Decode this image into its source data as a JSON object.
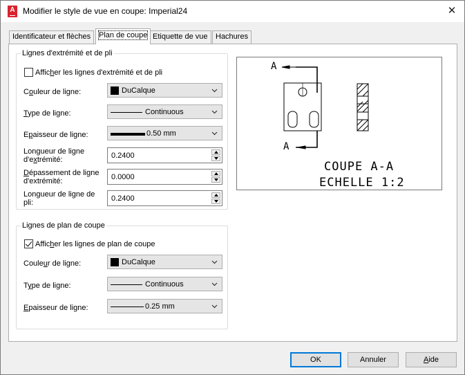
{
  "window": {
    "title": "Modifier le style de vue en coupe: Imperial24",
    "app_icon_letter": "A",
    "close_glyph": "✕"
  },
  "tabs": [
    {
      "label": "Identificateur et flèches",
      "active": false
    },
    {
      "label": "Plan de coupe",
      "active": true
    },
    {
      "label": "Etiquette de vue",
      "active": false
    },
    {
      "label": "Hachures",
      "active": false
    }
  ],
  "end_lines": {
    "group_title": "Lignes d'extrémité et de pli",
    "show_checkbox": {
      "label_pre": "Affic",
      "label_u": "h",
      "label_post": "er les lignes d'extrémité et de pli",
      "checked": false
    },
    "color": {
      "label_pre": "C",
      "label_u": "o",
      "label_post": "uleur de ligne:",
      "value": "DuCalque"
    },
    "linetype": {
      "label_pre": "",
      "label_u": "T",
      "label_post": "ype de ligne:",
      "value": "Continuous"
    },
    "lineweight": {
      "label_pre": "E",
      "label_u": "p",
      "label_post": "aisseur de ligne:",
      "value": "0.50 mm"
    },
    "end_length": {
      "label_l1": "Longueur de ligne",
      "label_l2_pre": "d'e",
      "label_l2_u": "x",
      "label_l2_post": "trémité:",
      "value": "0.2400"
    },
    "overshoot": {
      "label_l1_pre": "",
      "label_l1_u": "D",
      "label_l1_post": "épassement de ligne",
      "label_l2": "d'extrémité:",
      "value": "0.0000"
    },
    "bend_length": {
      "label_l1": "Longueur de ligne de",
      "label_l2": "pli:",
      "value": "0.2400"
    }
  },
  "cutting_plane": {
    "group_title": "Lignes de plan de coupe",
    "show_checkbox": {
      "label_pre": "Affic",
      "label_u": "h",
      "label_post": "er les lignes de plan de coupe",
      "checked": true
    },
    "color": {
      "label_pre": "Coule",
      "label_u": "u",
      "label_post": "r de ligne:",
      "value": "DuCalque"
    },
    "linetype": {
      "label_pre": "T",
      "label_u": "y",
      "label_post": "pe de ligne:",
      "value": "Continuous"
    },
    "lineweight": {
      "label_pre": "",
      "label_u": "E",
      "label_post": "paisseur de ligne:",
      "value": "0.25 mm"
    }
  },
  "preview": {
    "label_top": "A",
    "label_bottom": "A",
    "caption_line1": "COUPE A-A",
    "caption_line2": "ECHELLE 1:2"
  },
  "buttons": {
    "ok": "OK",
    "cancel": "Annuler",
    "help_u": "A",
    "help_rest": "ide"
  },
  "colors": {
    "accent": "#0078d7",
    "brand_icon": "#d9232e"
  }
}
